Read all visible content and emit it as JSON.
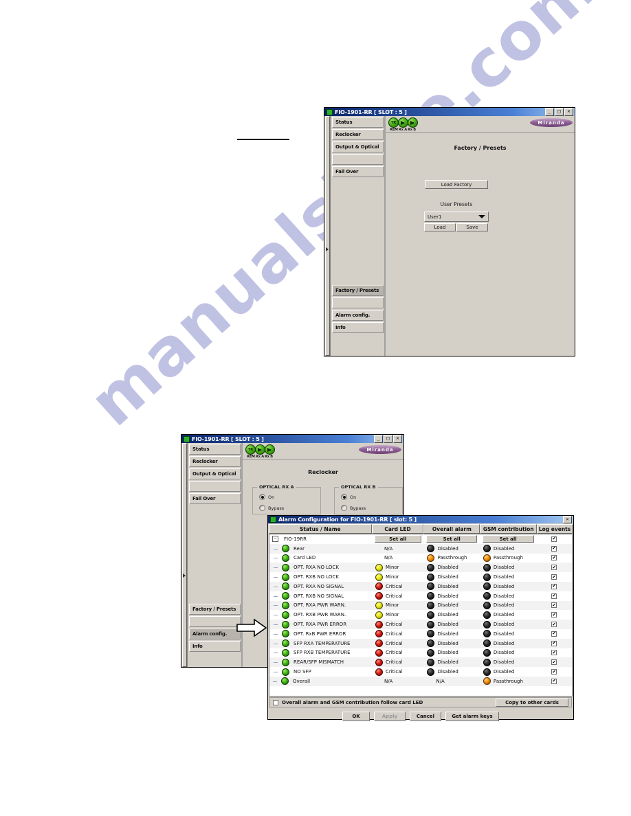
{
  "page": {
    "watermark": "manualshive.com",
    "rule_line": true
  },
  "window1": {
    "title": "FIO-1901-RR [ SLOT : 5 ]",
    "titlebar_icon": "status-led-icon",
    "buttons": {
      "minimize": "_",
      "maximize": "□",
      "close": "✕"
    },
    "status_leds": [
      {
        "name": "REM",
        "label": "REM",
        "type": "text",
        "text": "TR",
        "color": "#3fae12"
      },
      {
        "name": "Rx A",
        "label": "Rx A",
        "type": "arrow",
        "color": "#3fae12"
      },
      {
        "name": "Rx B",
        "label": "Rx B",
        "type": "arrow",
        "color": "#3fae12"
      }
    ],
    "logo": "Miranda",
    "nav": [
      {
        "label": "Status",
        "selected": false
      },
      {
        "label": "Reclocker",
        "selected": false
      },
      {
        "label": "Output & Optical",
        "selected": false
      },
      {
        "label": "",
        "selected": false
      },
      {
        "label": "Fail Over",
        "selected": false
      },
      {
        "label": "Factory / Presets",
        "selected": true
      },
      {
        "label": "",
        "selected": false
      },
      {
        "label": "Alarm config.",
        "selected": false
      },
      {
        "label": "Info",
        "selected": false
      }
    ],
    "panel_title": "Factory / Presets",
    "load_factory_button": "Load Factory",
    "user_presets_label": "User Presets",
    "preset_selected": "User1",
    "load_button": "Load",
    "save_button": "Save"
  },
  "window2": {
    "title": "FIO-1901-RR [ SLOT : 5 ]",
    "buttons": {
      "minimize": "_",
      "maximize": "□",
      "close": "✕"
    },
    "logo": "Miranda",
    "status_leds": [
      {
        "label": "REM",
        "text": "TR"
      },
      {
        "label": "Rx A",
        "text": ""
      },
      {
        "label": "Rx B",
        "text": ""
      }
    ],
    "nav": [
      {
        "label": "Status",
        "selected": false
      },
      {
        "label": "Reclocker",
        "selected": false
      },
      {
        "label": "Output & Optical",
        "selected": false
      },
      {
        "label": "",
        "selected": false
      },
      {
        "label": "Fail Over",
        "selected": false
      },
      {
        "label": "Factory / Presets",
        "selected": false
      },
      {
        "label": "",
        "selected": false
      },
      {
        "label": "Alarm config.",
        "selected": true
      },
      {
        "label": "Info",
        "selected": false
      }
    ],
    "panel_title": "Reclocker",
    "group_a": {
      "title": "OPTICAL RX A",
      "options": [
        {
          "label": "On",
          "checked": true
        },
        {
          "label": "Bypass",
          "checked": false
        }
      ]
    },
    "group_b": {
      "title": "OPTICAL RX B",
      "options": [
        {
          "label": "On",
          "checked": true
        },
        {
          "label": "Bypass",
          "checked": false
        }
      ]
    }
  },
  "alarm_dialog": {
    "title": "Alarm Configuration for FIO-1901-RR [ slot: 5 ]",
    "close_button": "✕",
    "columns": [
      "Status / Name",
      "Card LED",
      "Overall alarm",
      "GSM contribution",
      "Log events"
    ],
    "set_all_label": "Set all",
    "root_row": {
      "name": "FIO-19RR",
      "expander": "−",
      "log_events": true
    },
    "rows": [
      {
        "name": "Rear",
        "indent": 1,
        "status": "green",
        "card_led_text": "N/A",
        "card_led_dot": null,
        "overall": "Disabled",
        "overall_dot": "black",
        "gsm": "Disabled",
        "gsm_dot": "black",
        "log": true
      },
      {
        "name": "Card LED",
        "indent": 1,
        "status": "green",
        "card_led_text": "N/A",
        "card_led_dot": null,
        "overall": "Passthrough",
        "overall_dot": "orange",
        "gsm": "Passthrough",
        "gsm_dot": "orange",
        "log": true
      },
      {
        "name": "OPT. RXA NO LOCK",
        "indent": 1,
        "status": "green",
        "card_led_text": "Minor",
        "card_led_dot": "yellow",
        "overall": "Disabled",
        "overall_dot": "black",
        "gsm": "Disabled",
        "gsm_dot": "black",
        "log": true
      },
      {
        "name": "OPT. RXB NO LOCK",
        "indent": 1,
        "status": "green",
        "card_led_text": "Minor",
        "card_led_dot": "yellow",
        "overall": "Disabled",
        "overall_dot": "black",
        "gsm": "Disabled",
        "gsm_dot": "black",
        "log": true
      },
      {
        "name": "OPT. RXA NO SIGNAL",
        "indent": 1,
        "status": "green",
        "card_led_text": "Critical",
        "card_led_dot": "red",
        "overall": "Disabled",
        "overall_dot": "black",
        "gsm": "Disabled",
        "gsm_dot": "black",
        "log": true
      },
      {
        "name": "OPT. RXB NO SIGNAL",
        "indent": 1,
        "status": "green",
        "card_led_text": "Critical",
        "card_led_dot": "red",
        "overall": "Disabled",
        "overall_dot": "black",
        "gsm": "Disabled",
        "gsm_dot": "black",
        "log": true
      },
      {
        "name": "OPT. RXA PWR WARN.",
        "indent": 1,
        "status": "green",
        "card_led_text": "Minor",
        "card_led_dot": "yellow",
        "overall": "Disabled",
        "overall_dot": "black",
        "gsm": "Disabled",
        "gsm_dot": "black",
        "log": true
      },
      {
        "name": "OPT. RXB PWR WARN.",
        "indent": 1,
        "status": "green",
        "card_led_text": "Minor",
        "card_led_dot": "yellow",
        "overall": "Disabled",
        "overall_dot": "black",
        "gsm": "Disabled",
        "gsm_dot": "black",
        "log": true
      },
      {
        "name": "OPT. RXA PWR ERROR",
        "indent": 1,
        "status": "green",
        "card_led_text": "Critical",
        "card_led_dot": "red",
        "overall": "Disabled",
        "overall_dot": "black",
        "gsm": "Disabled",
        "gsm_dot": "black",
        "log": true
      },
      {
        "name": "OPT. RxB PWR ERROR",
        "indent": 1,
        "status": "green",
        "card_led_text": "Critical",
        "card_led_dot": "red",
        "overall": "Disabled",
        "overall_dot": "black",
        "gsm": "Disabled",
        "gsm_dot": "black",
        "log": true
      },
      {
        "name": "SFP RXA TEMPERATURE",
        "indent": 1,
        "status": "green",
        "card_led_text": "Critical",
        "card_led_dot": "red",
        "overall": "Disabled",
        "overall_dot": "black",
        "gsm": "Disabled",
        "gsm_dot": "black",
        "log": true
      },
      {
        "name": "SFP RXB TEMPERATURE",
        "indent": 1,
        "status": "green",
        "card_led_text": "Critical",
        "card_led_dot": "red",
        "overall": "Disabled",
        "overall_dot": "black",
        "gsm": "Disabled",
        "gsm_dot": "black",
        "log": true
      },
      {
        "name": "REAR/SFP MISMATCH",
        "indent": 1,
        "status": "green",
        "card_led_text": "Critical",
        "card_led_dot": "red",
        "overall": "Disabled",
        "overall_dot": "black",
        "gsm": "Disabled",
        "gsm_dot": "black",
        "log": true
      },
      {
        "name": "NO SFP",
        "indent": 1,
        "status": "green",
        "card_led_text": "Critical",
        "card_led_dot": "red",
        "overall": "Disabled",
        "overall_dot": "black",
        "gsm": "Disabled",
        "gsm_dot": "black",
        "log": true
      },
      {
        "name": "Overall",
        "indent": 1,
        "status": "green",
        "card_led_text": "N/A",
        "card_led_dot": null,
        "overall": "N/A",
        "overall_dot": null,
        "gsm": "Passthrough",
        "gsm_dot": "orange",
        "log": true
      }
    ],
    "follow_checkbox": {
      "label": "Overall alarm and GSM contribution follow card LED",
      "checked": false
    },
    "copy_button": "Copy to other cards",
    "footer_buttons": [
      {
        "label": "OK",
        "disabled": false
      },
      {
        "label": "Apply",
        "disabled": true
      },
      {
        "label": "Cancel",
        "disabled": false
      },
      {
        "label": "Get alarm keys",
        "disabled": false
      }
    ]
  }
}
